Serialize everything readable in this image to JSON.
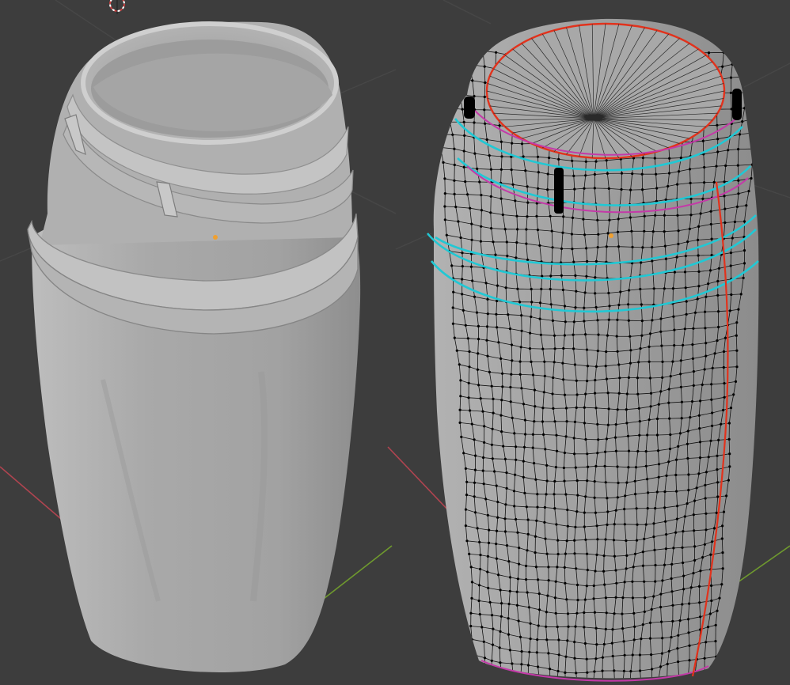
{
  "viewport": {
    "background": "#3d3d3d",
    "grid_line_color": "#4a4a4a",
    "x_axis_color": "#b04450",
    "y_axis_color": "#6f9a2e"
  },
  "objects": [
    {
      "name": "skirt-solid",
      "shading": "solid",
      "base_color": "#a9a9a9"
    },
    {
      "name": "skirt-wireframe",
      "shading": "solid-with-wireframe",
      "base_color": "#a0a0a0",
      "edge_color": "#111111",
      "vertex_color": "#000000"
    }
  ],
  "edge_marks": {
    "seam": "#e2321c",
    "sharp": "#21c8d4",
    "crease": "#c43aa8"
  },
  "origin_marker_color": "#f0a030",
  "cursor_3d": {
    "outer": "#c84040",
    "inner": "#ffffff"
  },
  "icons": [
    "3d-cursor-icon",
    "origin-point-icon"
  ]
}
